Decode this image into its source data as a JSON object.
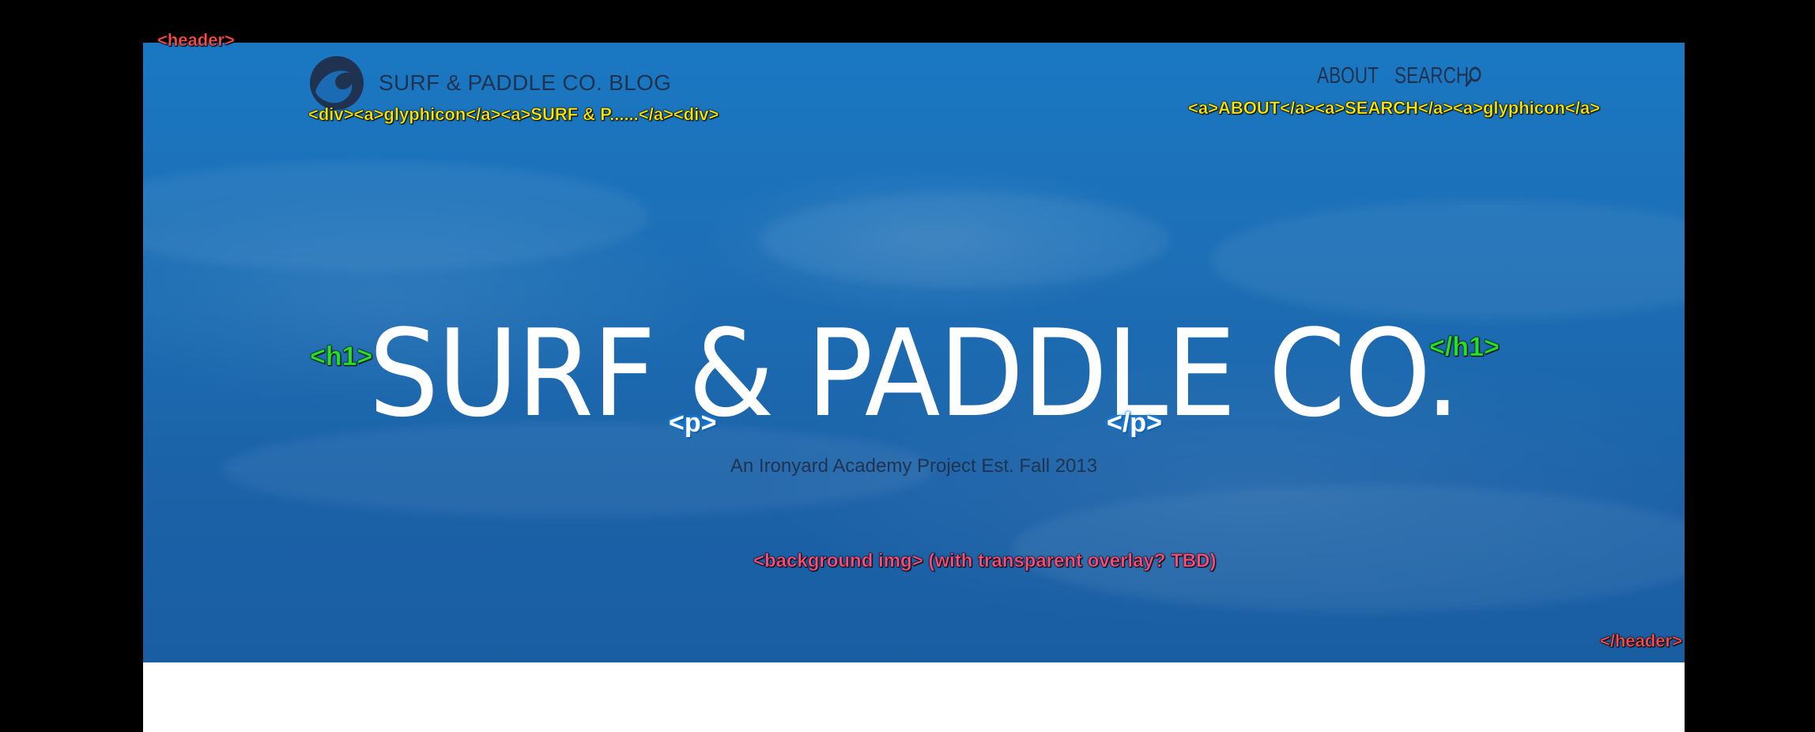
{
  "header": {
    "logo_text": "SURF & PADDLE CO. BLOG",
    "nav": {
      "about": "ABOUT",
      "search": "SEARCH"
    }
  },
  "hero": {
    "title": "SURF & PADDLE CO.",
    "subtitle": "An Ironyard Academy Project Est. Fall 2013"
  },
  "annotations": {
    "header_open": "<header>",
    "header_close": "</header>",
    "logo_div": "<div><a>glyphicon</a><a>SURF & P......</a><div>",
    "nav_links": "<a>ABOUT</a><a>SEARCH</a><a>glyphicon</a>",
    "h1_open": "<h1>",
    "h1_close": "</h1>",
    "p_open": "<p>",
    "p_close": "</p>",
    "background_note": "<background img> (with transparent overlay? TBD)"
  },
  "colors": {
    "hero_blue": "#1b6bb4",
    "dark_text": "#1f3350",
    "tag_red": "#ff4b4b",
    "tag_yellow": "#ffe600",
    "tag_green": "#25e025",
    "tag_blue": "#1f8fff"
  },
  "icons": {
    "logo": "wave-logo-icon",
    "search": "search-icon"
  }
}
